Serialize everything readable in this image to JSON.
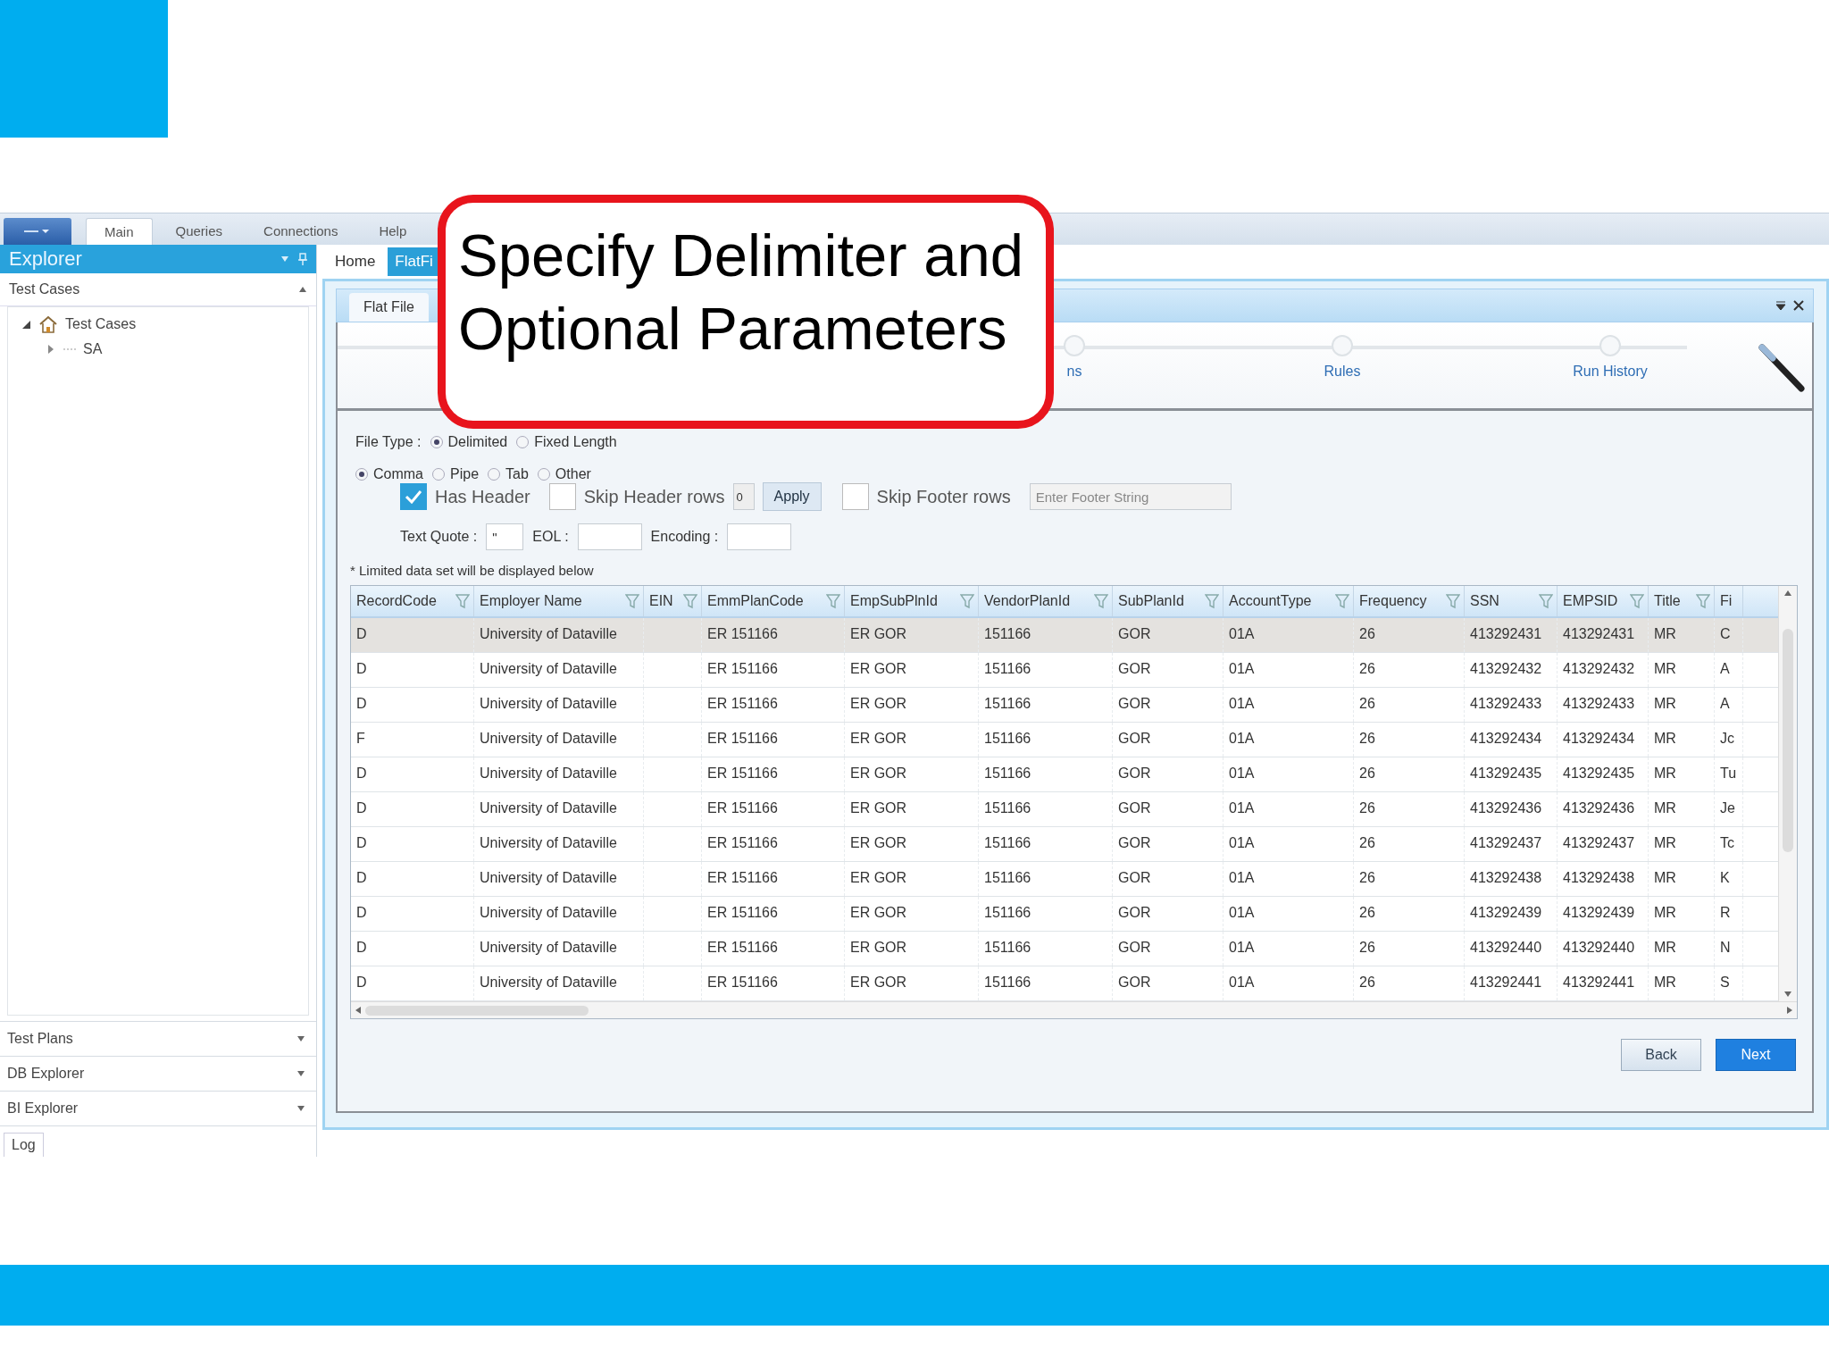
{
  "callout": {
    "text": "Specify Delimiter and Optional Parameters"
  },
  "menu": [
    {
      "label": "Main",
      "selected": true
    },
    {
      "label": "Queries",
      "selected": false
    },
    {
      "label": "Connections",
      "selected": false
    },
    {
      "label": "Help",
      "selected": false
    }
  ],
  "explorer": {
    "title": "Explorer",
    "section": "Test Cases",
    "tree": [
      {
        "label": "Test Cases",
        "expanded": true,
        "children": [
          {
            "label": "SA",
            "expanded": false
          }
        ]
      }
    ],
    "panels": [
      "Test Plans",
      "DB Explorer",
      "BI Explorer"
    ],
    "log_tab": "Log"
  },
  "doc_tabs": [
    {
      "label": "Home",
      "selected": false
    },
    {
      "label": "FlatFi",
      "selected": true
    }
  ],
  "wizard": {
    "tab": "Flat File",
    "steps": [
      {
        "label": "ns"
      },
      {
        "label": "Rules"
      },
      {
        "label": "Run History"
      }
    ],
    "file_type": {
      "label": "File Type :",
      "options": [
        {
          "label": "Delimited",
          "selected": true
        },
        {
          "label": "Fixed Length",
          "selected": false
        }
      ]
    },
    "delimiter": {
      "options": [
        {
          "label": "Comma",
          "selected": true
        },
        {
          "label": "Pipe",
          "selected": false
        },
        {
          "label": "Tab",
          "selected": false
        },
        {
          "label": "Other",
          "selected": false
        }
      ]
    },
    "has_header": {
      "label": "Has Header",
      "checked": true
    },
    "skip_header": {
      "label": "Skip Header rows",
      "checked": false,
      "value": "0"
    },
    "apply": "Apply",
    "skip_footer": {
      "label": "Skip Footer rows",
      "checked": false,
      "placeholder": "Enter Footer String"
    },
    "text_quote": {
      "label": "Text Quote :",
      "value": "\""
    },
    "eol": {
      "label": "EOL :"
    },
    "encoding": {
      "label": "Encoding :"
    },
    "note": "* Limited data set will be displayed below"
  },
  "table": {
    "columns": [
      {
        "label": "RecordCode",
        "filter": true
      },
      {
        "label": "Employer Name",
        "filter": true
      },
      {
        "label": "EIN",
        "filter": true
      },
      {
        "label": "EmmPlanCode",
        "filter": true
      },
      {
        "label": "EmpSubPlnId",
        "filter": true
      },
      {
        "label": "VendorPlanId",
        "filter": true
      },
      {
        "label": "SubPlanId",
        "filter": true
      },
      {
        "label": "AccountType",
        "filter": true
      },
      {
        "label": "Frequency",
        "filter": true
      },
      {
        "label": "SSN",
        "filter": true
      },
      {
        "label": "EMPSID",
        "filter": true
      },
      {
        "label": "Title",
        "filter": true
      },
      {
        "label": "Fi",
        "filter": false
      }
    ],
    "rows": [
      {
        "selected": true,
        "cells": [
          "D",
          "University of Dataville",
          "",
          "ER 151166",
          "ER GOR",
          "151166",
          "GOR",
          "01A",
          "26",
          "413292431",
          "413292431",
          "MR",
          "C"
        ]
      },
      {
        "selected": false,
        "cells": [
          "D",
          "University of Dataville",
          "",
          "ER 151166",
          "ER GOR",
          "151166",
          "GOR",
          "01A",
          "26",
          "413292432",
          "413292432",
          "MR",
          "A"
        ]
      },
      {
        "selected": false,
        "cells": [
          "D",
          "University of Dataville",
          "",
          "ER 151166",
          "ER GOR",
          "151166",
          "GOR",
          "01A",
          "26",
          "413292433",
          "413292433",
          "MR",
          "A"
        ]
      },
      {
        "selected": false,
        "cells": [
          "F",
          "University of Dataville",
          "",
          "ER 151166",
          "ER GOR",
          "151166",
          "GOR",
          "01A",
          "26",
          "413292434",
          "413292434",
          "MR",
          "Jc"
        ]
      },
      {
        "selected": false,
        "cells": [
          "D",
          "University of Dataville",
          "",
          "ER 151166",
          "ER GOR",
          "151166",
          "GOR",
          "01A",
          "26",
          "413292435",
          "413292435",
          "MR",
          "Tu"
        ]
      },
      {
        "selected": false,
        "cells": [
          "D",
          "University of Dataville",
          "",
          "ER 151166",
          "ER GOR",
          "151166",
          "GOR",
          "01A",
          "26",
          "413292436",
          "413292436",
          "MR",
          "Je"
        ]
      },
      {
        "selected": false,
        "cells": [
          "D",
          "University of Dataville",
          "",
          "ER 151166",
          "ER GOR",
          "151166",
          "GOR",
          "01A",
          "26",
          "413292437",
          "413292437",
          "MR",
          "Tc"
        ]
      },
      {
        "selected": false,
        "cells": [
          "D",
          "University of Dataville",
          "",
          "ER 151166",
          "ER GOR",
          "151166",
          "GOR",
          "01A",
          "26",
          "413292438",
          "413292438",
          "MR",
          "K"
        ]
      },
      {
        "selected": false,
        "cells": [
          "D",
          "University of Dataville",
          "",
          "ER 151166",
          "ER GOR",
          "151166",
          "GOR",
          "01A",
          "26",
          "413292439",
          "413292439",
          "MR",
          "R"
        ]
      },
      {
        "selected": false,
        "cells": [
          "D",
          "University of Dataville",
          "",
          "ER 151166",
          "ER GOR",
          "151166",
          "GOR",
          "01A",
          "26",
          "413292440",
          "413292440",
          "MR",
          "N"
        ]
      },
      {
        "selected": false,
        "cells": [
          "D",
          "University of Dataville",
          "",
          "ER 151166",
          "ER GOR",
          "151166",
          "GOR",
          "01A",
          "26",
          "413292441",
          "413292441",
          "MR",
          "S"
        ]
      }
    ]
  },
  "buttons": [
    {
      "label": "Back",
      "kind": "secondary"
    },
    {
      "label": "Next",
      "kind": "primary"
    }
  ]
}
